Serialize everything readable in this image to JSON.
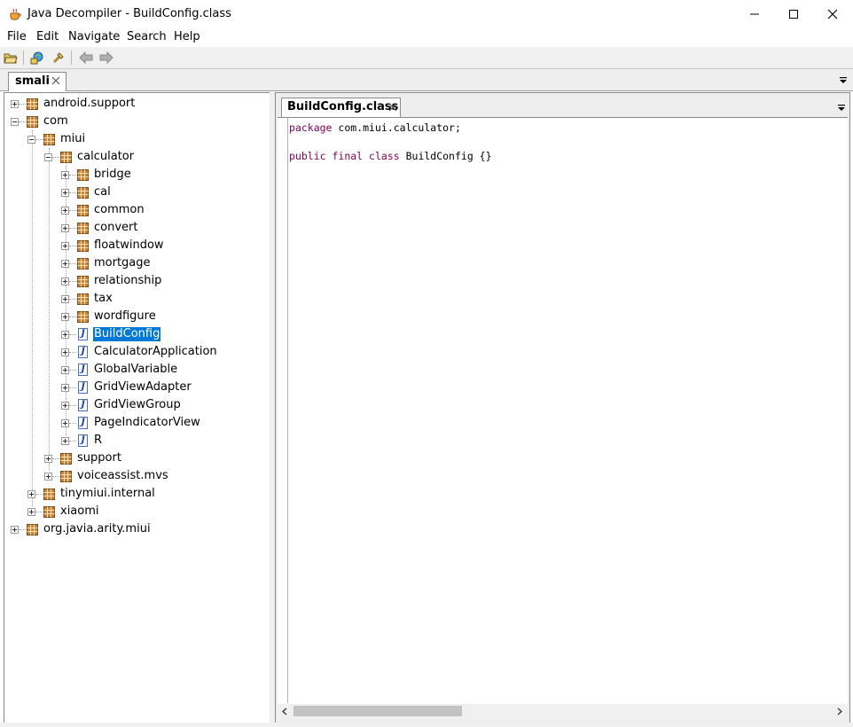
{
  "window": {
    "title": "Java Decompiler - BuildConfig.class",
    "minimize_glyph": "—",
    "maximize_glyph": "☐",
    "close_glyph": "✕"
  },
  "menu": {
    "items": [
      "File",
      "Edit",
      "Navigate",
      "Search",
      "Help"
    ]
  },
  "toolbar": {
    "buttons": [
      "open-folder-icon",
      "open-type-icon",
      "search-icon",
      "back-arrow-icon",
      "forward-arrow-icon"
    ]
  },
  "outer_tab": {
    "label": "smali"
  },
  "tree": {
    "nodes": [
      {
        "label": "android.support",
        "type": "package",
        "expander": "plus"
      },
      {
        "label": "com",
        "type": "package",
        "expander": "minus"
      },
      {
        "label": "miui",
        "type": "package",
        "expander": "minus"
      },
      {
        "label": "calculator",
        "type": "package",
        "expander": "minus"
      },
      {
        "label": "bridge",
        "type": "package",
        "expander": "plus"
      },
      {
        "label": "cal",
        "type": "package",
        "expander": "plus"
      },
      {
        "label": "common",
        "type": "package",
        "expander": "plus"
      },
      {
        "label": "convert",
        "type": "package",
        "expander": "plus"
      },
      {
        "label": "floatwindow",
        "type": "package",
        "expander": "plus"
      },
      {
        "label": "mortgage",
        "type": "package",
        "expander": "plus"
      },
      {
        "label": "relationship",
        "type": "package",
        "expander": "plus"
      },
      {
        "label": "tax",
        "type": "package",
        "expander": "plus"
      },
      {
        "label": "wordfigure",
        "type": "package",
        "expander": "plus"
      },
      {
        "label": "BuildConfig",
        "type": "class",
        "expander": "plus",
        "selected": true
      },
      {
        "label": "CalculatorApplication",
        "type": "class",
        "expander": "plus"
      },
      {
        "label": "GlobalVariable",
        "type": "class",
        "expander": "plus"
      },
      {
        "label": "GridViewAdapter",
        "type": "class",
        "expander": "plus"
      },
      {
        "label": "GridViewGroup",
        "type": "class",
        "expander": "plus"
      },
      {
        "label": "PageIndicatorView",
        "type": "class",
        "expander": "plus"
      },
      {
        "label": "R",
        "type": "class",
        "expander": "plus"
      },
      {
        "label": "support",
        "type": "package",
        "expander": "plus"
      },
      {
        "label": "voiceassist.mvs",
        "type": "package",
        "expander": "plus"
      },
      {
        "label": "tinymiui.internal",
        "type": "package",
        "expander": "plus"
      },
      {
        "label": "xiaomi",
        "type": "package",
        "expander": "plus"
      },
      {
        "label": "org.javia.arity.miui",
        "type": "package",
        "expander": "plus"
      }
    ],
    "class_icon_letter": "J"
  },
  "editor": {
    "tab_label": "BuildConfig.class",
    "code": {
      "line1_keyword": "package",
      "line1_rest": " com.miui.calculator;",
      "line2_kw1": "public",
      "line2_kw2": "final",
      "line2_kw3": "class",
      "line2_rest": " BuildConfig {}"
    }
  },
  "colors": {
    "keyword": "#7f0055",
    "selection": "#0078d7",
    "package_icon": "#c8843c"
  }
}
